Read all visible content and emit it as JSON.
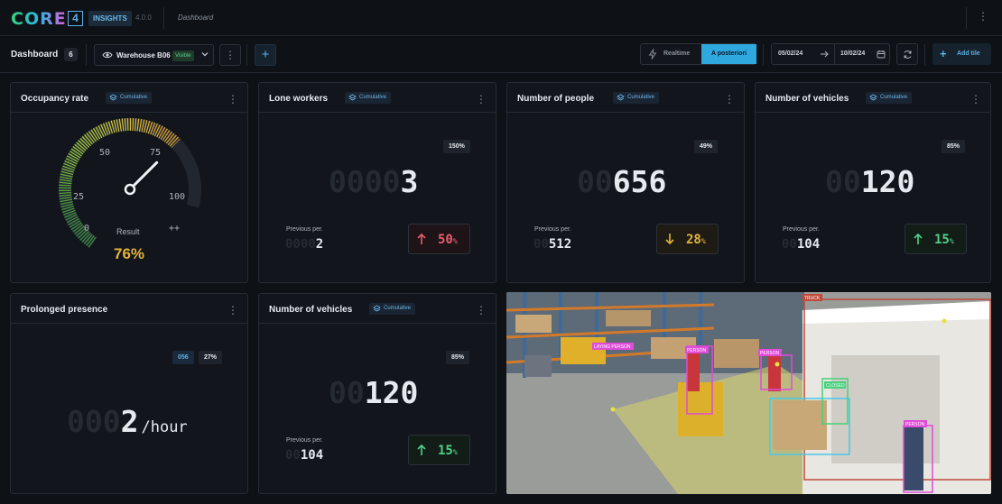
{
  "app": {
    "logo": "CORE",
    "logo_number": "4",
    "product": "INSIGHTS",
    "version": "4.0.0",
    "breadcrumb": "Dashboard"
  },
  "toolbar": {
    "title": "Dashboard",
    "count": "6",
    "site": "Warehouse B06",
    "visibility": "Visible",
    "mode_realtime": "Realtime",
    "mode_posteriori": "A posteriori",
    "date_from": "05/02/24",
    "date_to": "10/02/24",
    "add_tile": "Add tile"
  },
  "tiles": {
    "occupancy": {
      "title": "Occupancy rate",
      "tag": "Cumulative",
      "gauge_ticks": [
        "0",
        "25",
        "50",
        "75",
        "100",
        "++"
      ],
      "result_label": "Result",
      "result_value": "76%",
      "result_fraction": 0.76
    },
    "lone": {
      "title": "Lone workers",
      "tag": "Cumulative",
      "badge": "150%",
      "ghost": "0000",
      "value": "3",
      "prev_label": "Previous per.",
      "prev_ghost": "0000",
      "prev_value": "2",
      "trend_value": "50",
      "trend_unit": "%"
    },
    "people": {
      "title": "Number of people",
      "tag": "Cumulative",
      "badge": "49%",
      "ghost": "00",
      "value": "656",
      "prev_label": "Previous per.",
      "prev_ghost": "00",
      "prev_value": "512",
      "trend_value": "28",
      "trend_unit": "%"
    },
    "vehicles1": {
      "title": "Number of vehicles",
      "tag": "Cumulative",
      "badge": "85%",
      "ghost": "00",
      "value": "120",
      "prev_label": "Previous per.",
      "prev_ghost": "00",
      "prev_value": "104",
      "trend_value": "15",
      "trend_unit": "%"
    },
    "prolonged": {
      "title": "Prolonged presence",
      "badge_blue": "056",
      "badge": "27%",
      "ghost": "000",
      "value": "2",
      "unit": "/hour"
    },
    "vehicles2": {
      "title": "Number of vehicles",
      "tag": "Cumulative",
      "badge": "85%",
      "ghost": "00",
      "value": "120",
      "prev_label": "Previous per.",
      "prev_ghost": "00",
      "prev_value": "104",
      "trend_value": "15",
      "trend_unit": "%"
    }
  },
  "camera": {
    "labels": [
      "LAYING PERSON",
      "PERSON",
      "PERSON",
      "TRUCK",
      "PERSON",
      "CLOSED"
    ]
  },
  "colors": {
    "accent": "#2fa8e0",
    "up_red": "#ea5b6d",
    "down_yellow": "#e5b43a",
    "up_green": "#4ed18a",
    "occupancy": "#e5b43a"
  }
}
